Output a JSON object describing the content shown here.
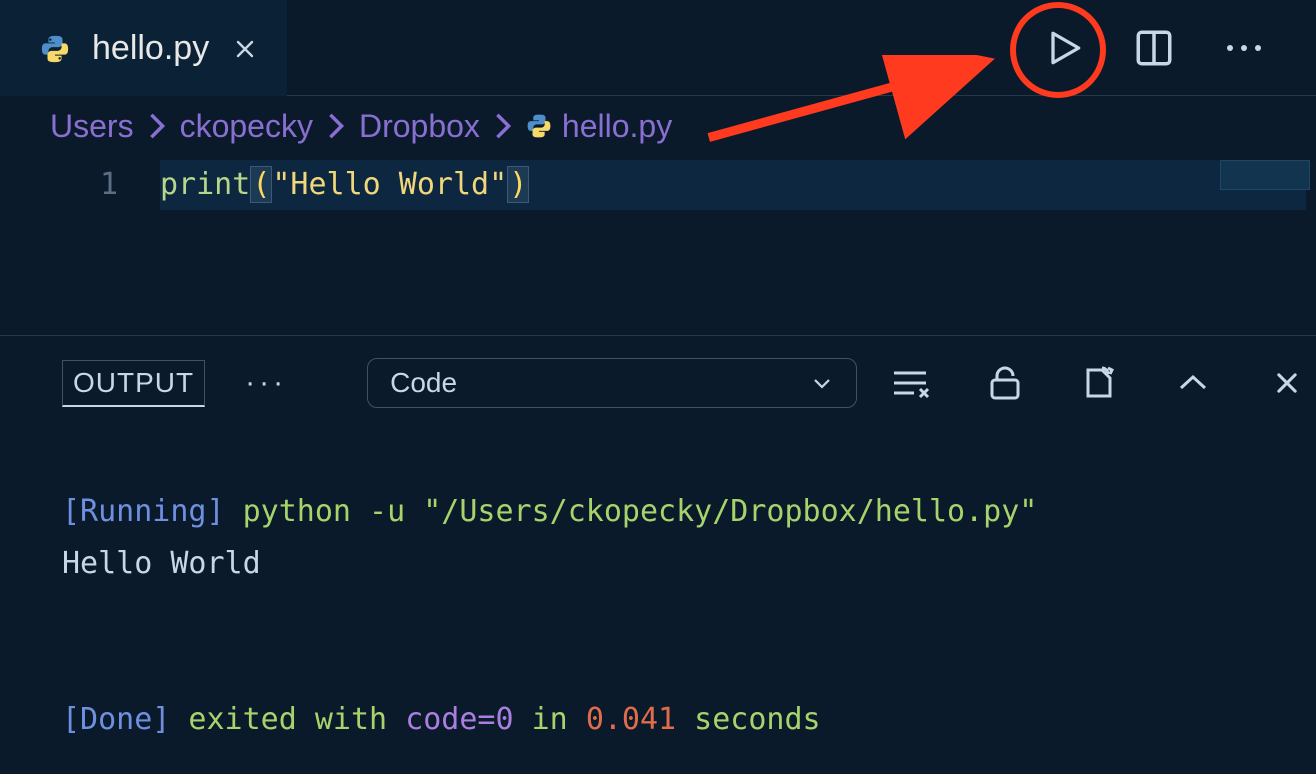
{
  "tab": {
    "filename": "hello.py",
    "icon": "python-icon"
  },
  "breadcrumb": {
    "segments": [
      "Users",
      "ckopecky",
      "Dropbox"
    ],
    "file": "hello.py"
  },
  "editor": {
    "line_number": "1",
    "code_tokens": {
      "func": "print",
      "open_paren": "(",
      "string": "\"Hello World\"",
      "close_paren": ")"
    }
  },
  "panel": {
    "tab_label": "OUTPUT",
    "selector_value": "Code"
  },
  "output": {
    "running_label": "[Running]",
    "running_cmd": " python -u \"/Users/ckopecky/Dropbox/hello.py\"",
    "stdout": "Hello World",
    "done_label": "[Done]",
    "done_prefix": " exited with ",
    "done_code_label": "code=0",
    "done_in": " in ",
    "done_time": "0.041",
    "done_suffix": " seconds"
  },
  "colors": {
    "annotation": "#ff3a1f"
  }
}
